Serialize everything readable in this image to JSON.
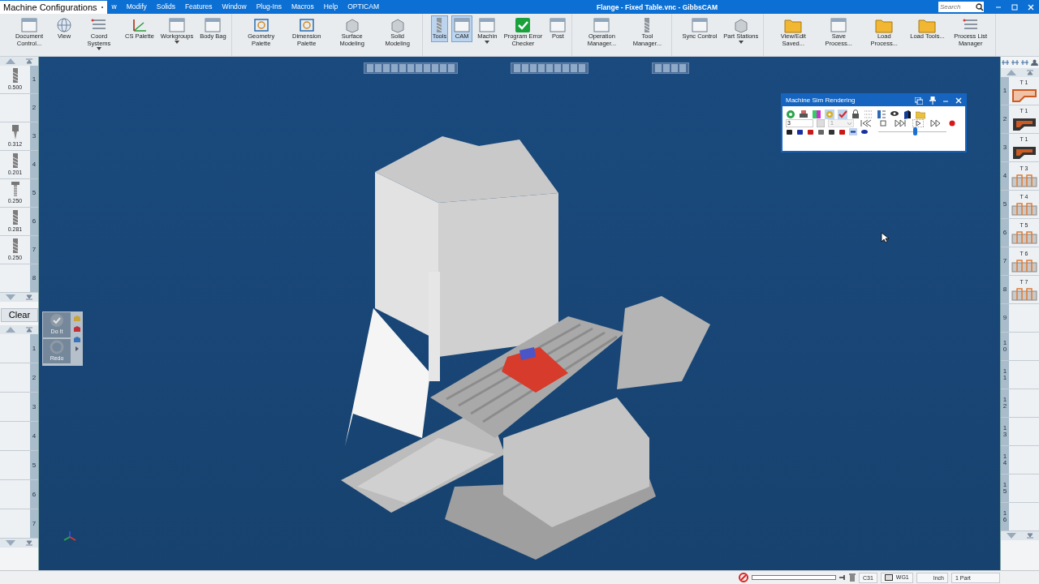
{
  "window": {
    "title": "Flange - Fixed Table.vnc - GibbsCAM",
    "search_placeholder": "Search"
  },
  "config_label": "Machine Configurations",
  "menu": [
    "w",
    "Modify",
    "Solids",
    "Features",
    "Window",
    "Plug-Ins",
    "Macros",
    "Help",
    "OPTICAM"
  ],
  "ribbon": [
    {
      "buttons": [
        {
          "label": "Document Control...",
          "selected": false,
          "dropdown": false
        },
        {
          "label": "View",
          "selected": false,
          "dropdown": false
        },
        {
          "label": "Coord Systems",
          "selected": false,
          "dropdown": true
        },
        {
          "label": "CS Palette",
          "selected": false,
          "dropdown": false
        },
        {
          "label": "Workgroups",
          "selected": false,
          "dropdown": true
        },
        {
          "label": "Body Bag",
          "selected": false,
          "dropdown": false
        }
      ]
    },
    {
      "buttons": [
        {
          "label": "Geometry Palette",
          "selected": false,
          "dropdown": false
        },
        {
          "label": "Dimension Palette",
          "selected": false,
          "dropdown": false
        },
        {
          "label": "Surface Modeling",
          "selected": false,
          "dropdown": false
        },
        {
          "label": "Solid Modeling",
          "selected": false,
          "dropdown": false
        }
      ]
    },
    {
      "buttons": [
        {
          "label": "Tools",
          "selected": true,
          "dropdown": false
        },
        {
          "label": "CAM",
          "selected": true,
          "dropdown": false
        },
        {
          "label": "Machin",
          "selected": false,
          "dropdown": true
        },
        {
          "label": "Program Error Checker",
          "selected": false,
          "dropdown": false
        },
        {
          "label": "Post",
          "selected": false,
          "dropdown": false
        }
      ]
    },
    {
      "buttons": [
        {
          "label": "Operation Manager...",
          "selected": false,
          "dropdown": false
        },
        {
          "label": "Tool Manager...",
          "selected": false,
          "dropdown": false
        }
      ]
    },
    {
      "buttons": [
        {
          "label": "Sync Control",
          "selected": false,
          "dropdown": false
        },
        {
          "label": "Part Stations",
          "selected": false,
          "dropdown": true
        }
      ]
    },
    {
      "buttons": [
        {
          "label": "View/Edit Saved...",
          "selected": false,
          "dropdown": false
        },
        {
          "label": "Save Process...",
          "selected": false,
          "dropdown": false
        },
        {
          "label": "Load Process...",
          "selected": false,
          "dropdown": false
        },
        {
          "label": "Load Tools...",
          "selected": false,
          "dropdown": false
        },
        {
          "label": "Process List Manager",
          "selected": false,
          "dropdown": false
        }
      ]
    }
  ],
  "tool_list": [
    {
      "number": "1",
      "size": "0.500",
      "kind": "endmill"
    },
    {
      "number": "2"
    },
    {
      "number": "3",
      "size": "0.312",
      "kind": "spot"
    },
    {
      "number": "4",
      "size": "0.201",
      "kind": "endmill"
    },
    {
      "number": "5",
      "size": "0.250",
      "kind": "tap"
    },
    {
      "number": "6",
      "size": "0.281",
      "kind": "endmill"
    },
    {
      "number": "7",
      "size": "0.250",
      "kind": "endmill"
    },
    {
      "number": "8"
    }
  ],
  "clear_button": "Clear",
  "process_list": [
    "1",
    "2",
    "3",
    "4",
    "5",
    "6",
    "7"
  ],
  "process_actions": [
    {
      "label": "Do It",
      "disabled": true
    },
    {
      "label": "Redo",
      "disabled": true
    }
  ],
  "operations": [
    {
      "number": "1",
      "tool": "T 1",
      "kind": "contour"
    },
    {
      "number": "2",
      "tool": "T 1",
      "kind": "pocket"
    },
    {
      "number": "3",
      "tool": "T 1",
      "kind": "pocket"
    },
    {
      "number": "4",
      "tool": "T 3",
      "kind": "slot"
    },
    {
      "number": "5",
      "tool": "T 4",
      "kind": "slot"
    },
    {
      "number": "6",
      "tool": "T 5",
      "kind": "slot"
    },
    {
      "number": "7",
      "tool": "T 6",
      "kind": "slot"
    },
    {
      "number": "8",
      "tool": "T 7",
      "kind": "slot"
    },
    {
      "number": "9"
    },
    {
      "number": "10"
    },
    {
      "number": "11"
    },
    {
      "number": "12"
    },
    {
      "number": "13"
    },
    {
      "number": "14"
    },
    {
      "number": "15"
    },
    {
      "number": "16"
    }
  ],
  "sim_dialog": {
    "title": "Machine Sim Rendering",
    "step_value": "3",
    "speed_value": "1",
    "slider": {
      "level": 0.53
    }
  },
  "status_bar": {
    "progress": {
      "level": 0
    },
    "coord_system": "C31",
    "workgroup": "WG1",
    "units": "Inch",
    "parts": "1 Part"
  }
}
